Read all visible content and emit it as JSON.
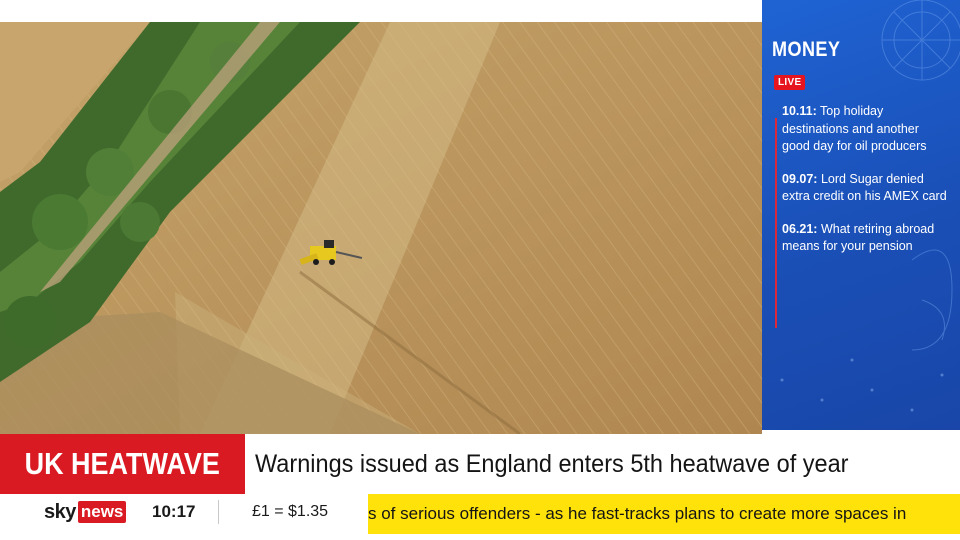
{
  "panel": {
    "title": "MONEY",
    "live_label": "LIVE",
    "items": [
      {
        "time": "10.11:",
        "text": "Top holiday destinations and another good day for oil producers"
      },
      {
        "time": "09.07:",
        "text": "Lord Sugar denied extra credit on his AMEX card"
      },
      {
        "time": "06.21:",
        "text": "What retiring abroad means for your pension"
      }
    ]
  },
  "strap": {
    "tag": "UK HEATWAVE",
    "headline": "Warnings issued as England enters 5th heatwave of year"
  },
  "ticker": {
    "logo_sky": "sky",
    "logo_news": "news",
    "time": "10:17",
    "fx": "£1 = $1.35",
    "scroll_text": "s of serious offenders - as he fast-tracks plans to create more spaces in"
  },
  "colors": {
    "brand_red": "#d91a23",
    "ticker_yellow": "#ffe20a",
    "money_blue": "#1f5bc9"
  },
  "icons": {
    "combine_harvester": "combine-harvester-icon"
  }
}
